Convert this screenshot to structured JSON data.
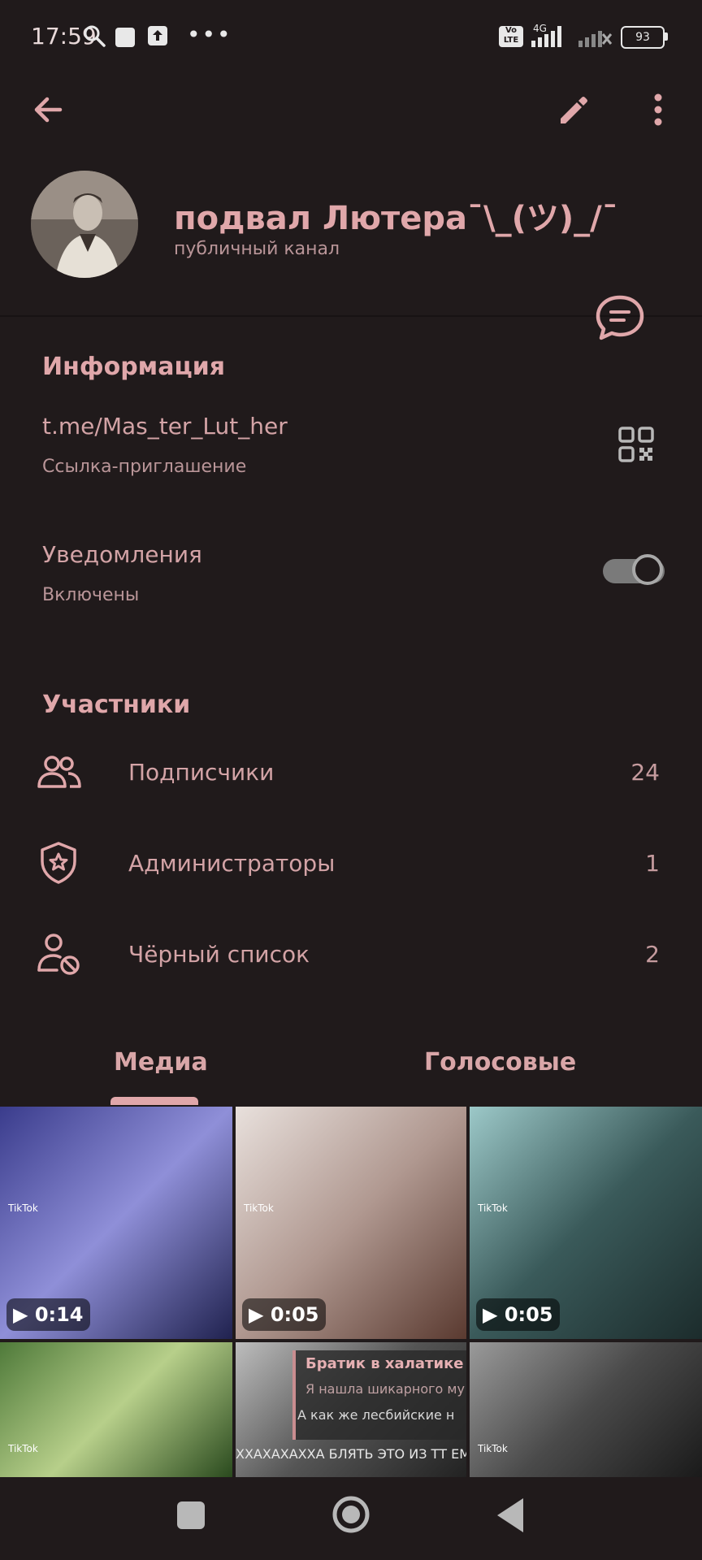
{
  "status_bar": {
    "time": "17:59",
    "volte": "Vo LTE",
    "network": "4G",
    "battery": "93"
  },
  "channel": {
    "name": "подвал Лютера¯\\_(ツ)_/¯",
    "type": "публичный канал"
  },
  "info": {
    "heading": "Информация",
    "link": "t.me/Mas_ter_Lut_her",
    "link_caption": "Ссылка-приглашение",
    "notifications_label": "Уведомления",
    "notifications_state": "Включены",
    "notifications_on": true
  },
  "members": {
    "heading": "Участники",
    "rows": [
      {
        "label": "Подписчики",
        "count": "24",
        "icon": "people-icon"
      },
      {
        "label": "Администраторы",
        "count": "1",
        "icon": "shield-star-icon"
      },
      {
        "label": "Чёрный список",
        "count": "2",
        "icon": "user-block-icon"
      }
    ]
  },
  "tabs": [
    "Медиа",
    "Голосовые"
  ],
  "active_tab": 0,
  "media": [
    {
      "duration": "0:14",
      "source": "TikTok",
      "colors": [
        "#3a3c8c",
        "#8f8fd8",
        "#20224f"
      ]
    },
    {
      "duration": "0:05",
      "source": "TikTok",
      "colors": [
        "#e8e0dc",
        "#b09890",
        "#5a3a30"
      ]
    },
    {
      "duration": "0:05",
      "source": "TikTok",
      "colors": [
        "#9cc8c8",
        "#3a5a5a",
        "#1c2c2c"
      ]
    },
    {
      "duration": "",
      "source": "TikTok",
      "colors": [
        "#4f7a3a",
        "#b7cf8a",
        "#2a4a1e"
      ]
    },
    {
      "duration": "",
      "source": "",
      "caption_title": "Братик в халатике",
      "caption_line1": "Я нашла шикарного му",
      "caption_line2": "А как же лесбийские н",
      "caption_bottom": "ХХАХАХАХХА БЛЯТЬ ЭТО ИЗ ТТ ЕМА",
      "colors": [
        "#bdbdbd",
        "#555555",
        "#222222"
      ]
    },
    {
      "duration": "",
      "source": "TikTok",
      "colors": [
        "#9a9a9a",
        "#4a4a4a",
        "#1a1a1a"
      ]
    }
  ]
}
